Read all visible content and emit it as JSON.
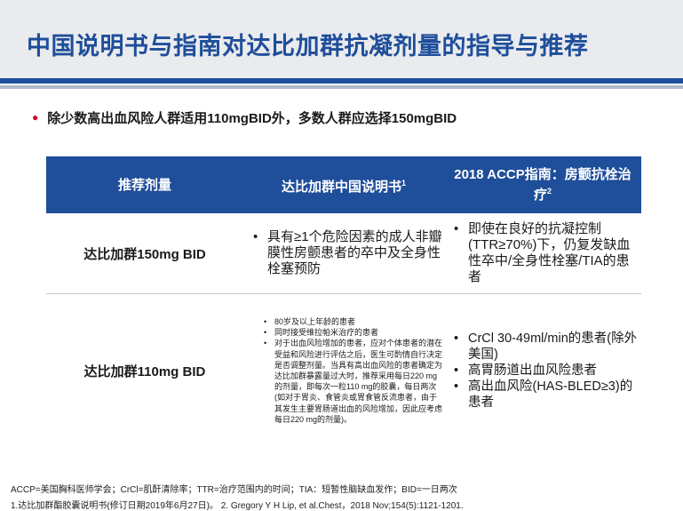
{
  "slide": {
    "title": "中国说明书与指南对达比加群抗凝剂量的指导与推荐",
    "intro": "除少数高出血风险人群适用110mgBID外，多数人群应选择150mgBID"
  },
  "table": {
    "headers": {
      "col1": "推荐剂量",
      "col2": "达比加群中国说明书",
      "col2_sup": "1",
      "col3": "2018 ACCP指南：房颤抗栓治疗",
      "col3_sup": "2"
    },
    "row1": {
      "dose": "达比加群150mg BID",
      "label_items": [
        "具有≥1个危险因素的成人非瓣膜性房颤患者的卒中及全身性栓塞预防"
      ],
      "guideline_items": [
        "即使在良好的抗凝控制(TTR≥70%)下，仍复发缺血性卒中/全身性栓塞/TIA的患者"
      ]
    },
    "row2": {
      "dose": "达比加群110mg BID",
      "label_items": [
        "80岁及以上年龄的患者",
        "同时接受维拉帕米治疗的患者",
        "对于出血风险增加的患者，应对个体患者的潜在受益和风险进行评估之后，医生可酌情自行决定是否调整剂量。当具有高出血风险的患者确定为达比加群暴露量过大时，推荐采用每日220 mg的剂量，即每次一粒110 mg的胶囊，每日两次(如对于胃炎、食管炎或胃食管反流患者，由于其发生主要胃肠道出血的风险增加，因此应考虑每日220 mg的剂量)。"
      ],
      "guideline_items": [
        "CrCl 30-49ml/min的患者(除外美国)",
        "高胃肠道出血风险患者",
        "高出血风险(HAS-BLED≥3)的患者"
      ]
    }
  },
  "footer": {
    "abbreviations": "ACCP=美国胸科医师学会；CrCl=肌酐清除率；TTR=治疗范围内的时间；TIA：短暂性脑缺血发作；BID=一日两次",
    "references": "1.达比加群酯胶囊说明书(修订日期2019年6月27日)。 2. Gregory Y H Lip, et al.Chest，2018 Nov;154(5):1121-1201."
  },
  "colors": {
    "brand_blue": "#1f4e9a",
    "bullet_red": "#c8102e",
    "header_band": "#e9ebee"
  }
}
